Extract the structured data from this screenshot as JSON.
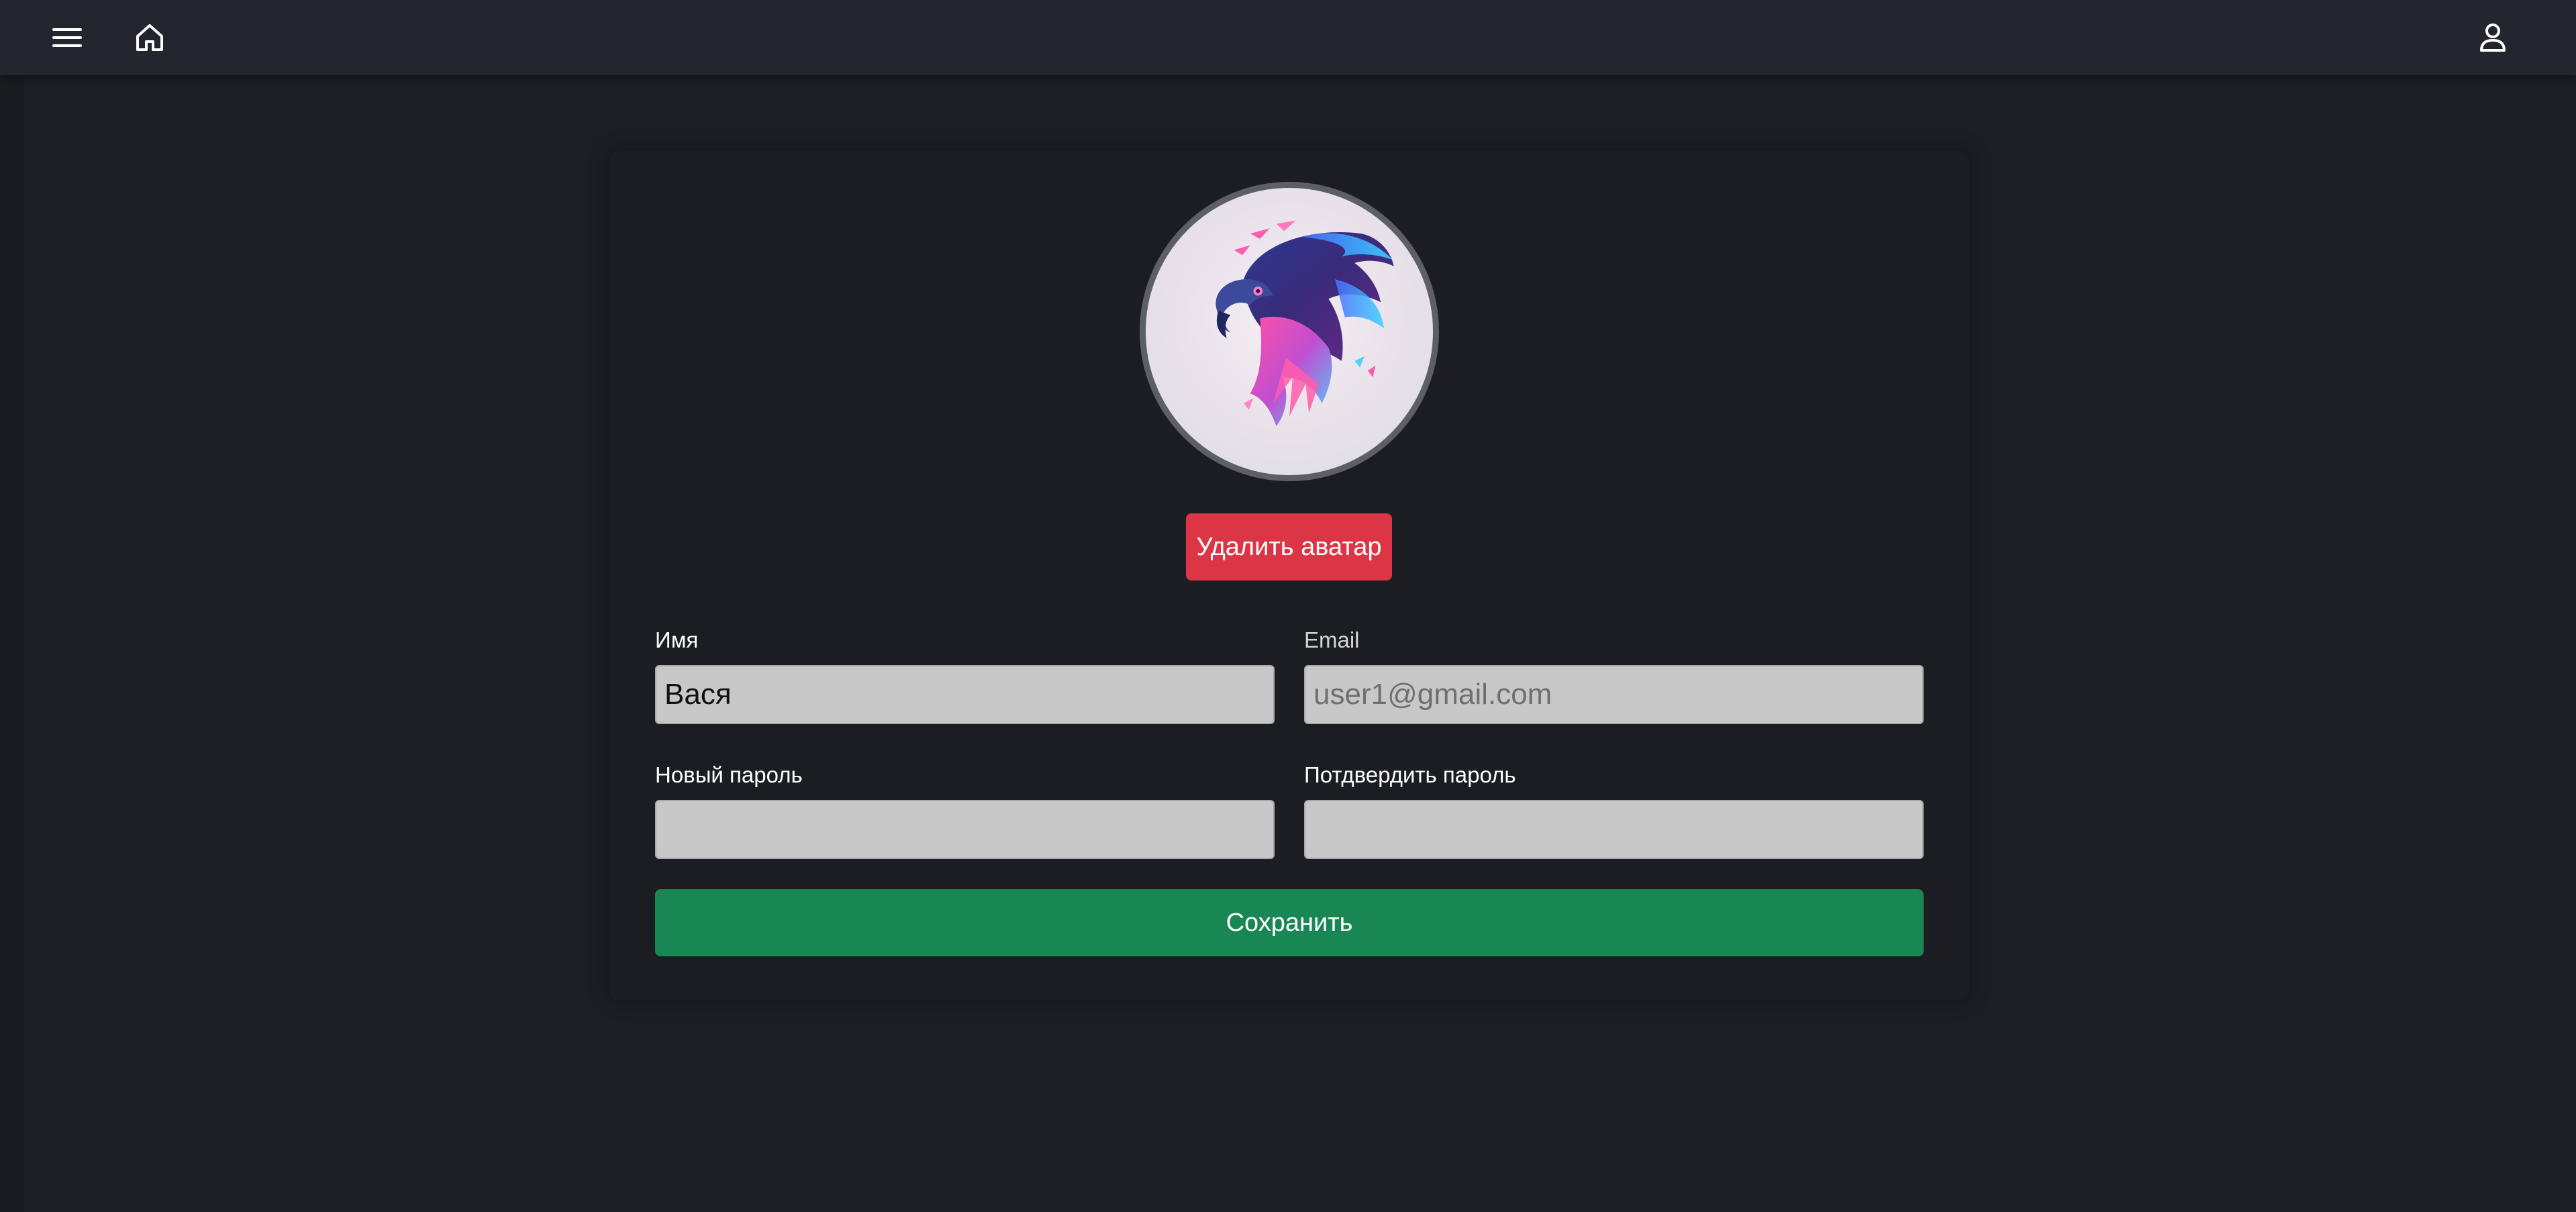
{
  "header": {
    "icons": {
      "menu": "hamburger-menu-icon",
      "home": "home-icon",
      "user": "user-icon"
    }
  },
  "profile": {
    "avatar": {
      "image": "eagle head illustration"
    },
    "delete_avatar_label": "Удалить аватар",
    "fields": {
      "name": {
        "label": "Имя",
        "value": "Вася"
      },
      "email": {
        "label": "Email",
        "value": "user1@gmail.com"
      },
      "new_password": {
        "label": "Новый пароль",
        "value": ""
      },
      "confirm_password": {
        "label": "Потдвердить пароль",
        "value": ""
      }
    },
    "save_label": "Сохранить"
  },
  "colors": {
    "background": "#1c1e24",
    "topbar": "#23262e",
    "danger": "#dc3545",
    "success": "#198754",
    "input_bg": "#c8c8c8"
  }
}
